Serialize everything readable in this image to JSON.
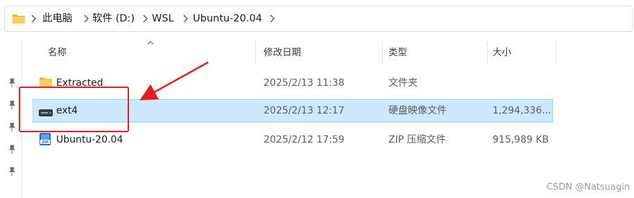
{
  "breadcrumb": {
    "items": [
      "此电脑",
      "软件 (D:)",
      "WSL",
      "Ubuntu-20.04"
    ]
  },
  "columns": {
    "name": "名称",
    "modified": "修改日期",
    "type": "类型",
    "size": "大小"
  },
  "files": [
    {
      "name": "Extracted",
      "modified": "2025/2/13 11:38",
      "type": "文件夹",
      "size": "",
      "icon": "folder-icon",
      "selected": false
    },
    {
      "name": "ext4",
      "modified": "2025/2/13 12:17",
      "type": "硬盘映像文件",
      "size": "1,294,336...",
      "icon": "disk-image-icon",
      "selected": true
    },
    {
      "name": "Ubuntu-20.04",
      "modified": "2025/2/12 17:59",
      "type": "ZIP 压缩文件",
      "size": "915,989 KB",
      "icon": "zip-icon",
      "selected": false
    }
  ],
  "watermark": "CSDN @Natsuagin",
  "colors": {
    "selection_bg": "#cce8ff",
    "selection_border": "#99d1ff",
    "annotation": "#e51c1c",
    "folder": "#f5c542"
  }
}
